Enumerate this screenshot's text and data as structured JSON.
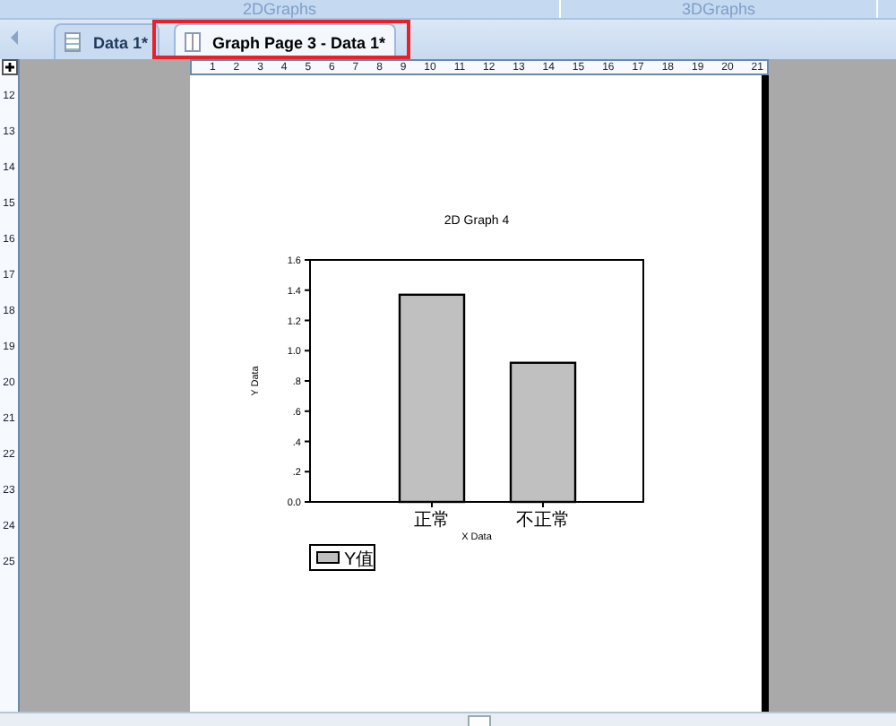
{
  "ribbon_groups": [
    "2DGraphs",
    "3DGraphs"
  ],
  "tabs": [
    {
      "label": "Data 1*",
      "kind": "worksheet",
      "selected": false
    },
    {
      "label": "Graph Page 3 - Data 1*",
      "kind": "graph",
      "selected": true
    }
  ],
  "horizontal_ruler": [
    "1",
    "2",
    "3",
    "4",
    "5",
    "6",
    "7",
    "8",
    "9",
    "10",
    "11",
    "12",
    "13",
    "14",
    "15",
    "16",
    "17",
    "18",
    "19",
    "20",
    "21"
  ],
  "vertical_ruler": [
    "12",
    "13",
    "14",
    "15",
    "16",
    "17",
    "18",
    "19",
    "20",
    "21",
    "22",
    "23",
    "24",
    "25"
  ],
  "chart": {
    "chart_data": {
      "type": "bar",
      "title": "2D Graph 4",
      "xlabel": "X Data",
      "ylabel": "Y Data",
      "categories": [
        "正常",
        "不正常"
      ],
      "series": [
        {
          "name": "Y值",
          "color": "#c0c0c0",
          "values": [
            1.37,
            0.92
          ]
        }
      ],
      "ylim": [
        0,
        1.6
      ],
      "yticks": [
        {
          "value": 0,
          "label": "0.0"
        },
        {
          "value": 0.2,
          "label": ".2"
        },
        {
          "value": 0.4,
          "label": ".4"
        },
        {
          "value": 0.6,
          "label": ".6"
        },
        {
          "value": 0.8,
          "label": ".8"
        },
        {
          "value": 1.0,
          "label": "1.0"
        },
        {
          "value": 1.2,
          "label": "1.2"
        },
        {
          "value": 1.4,
          "label": "1.4"
        },
        {
          "value": 1.6,
          "label": "1.6"
        }
      ]
    }
  }
}
